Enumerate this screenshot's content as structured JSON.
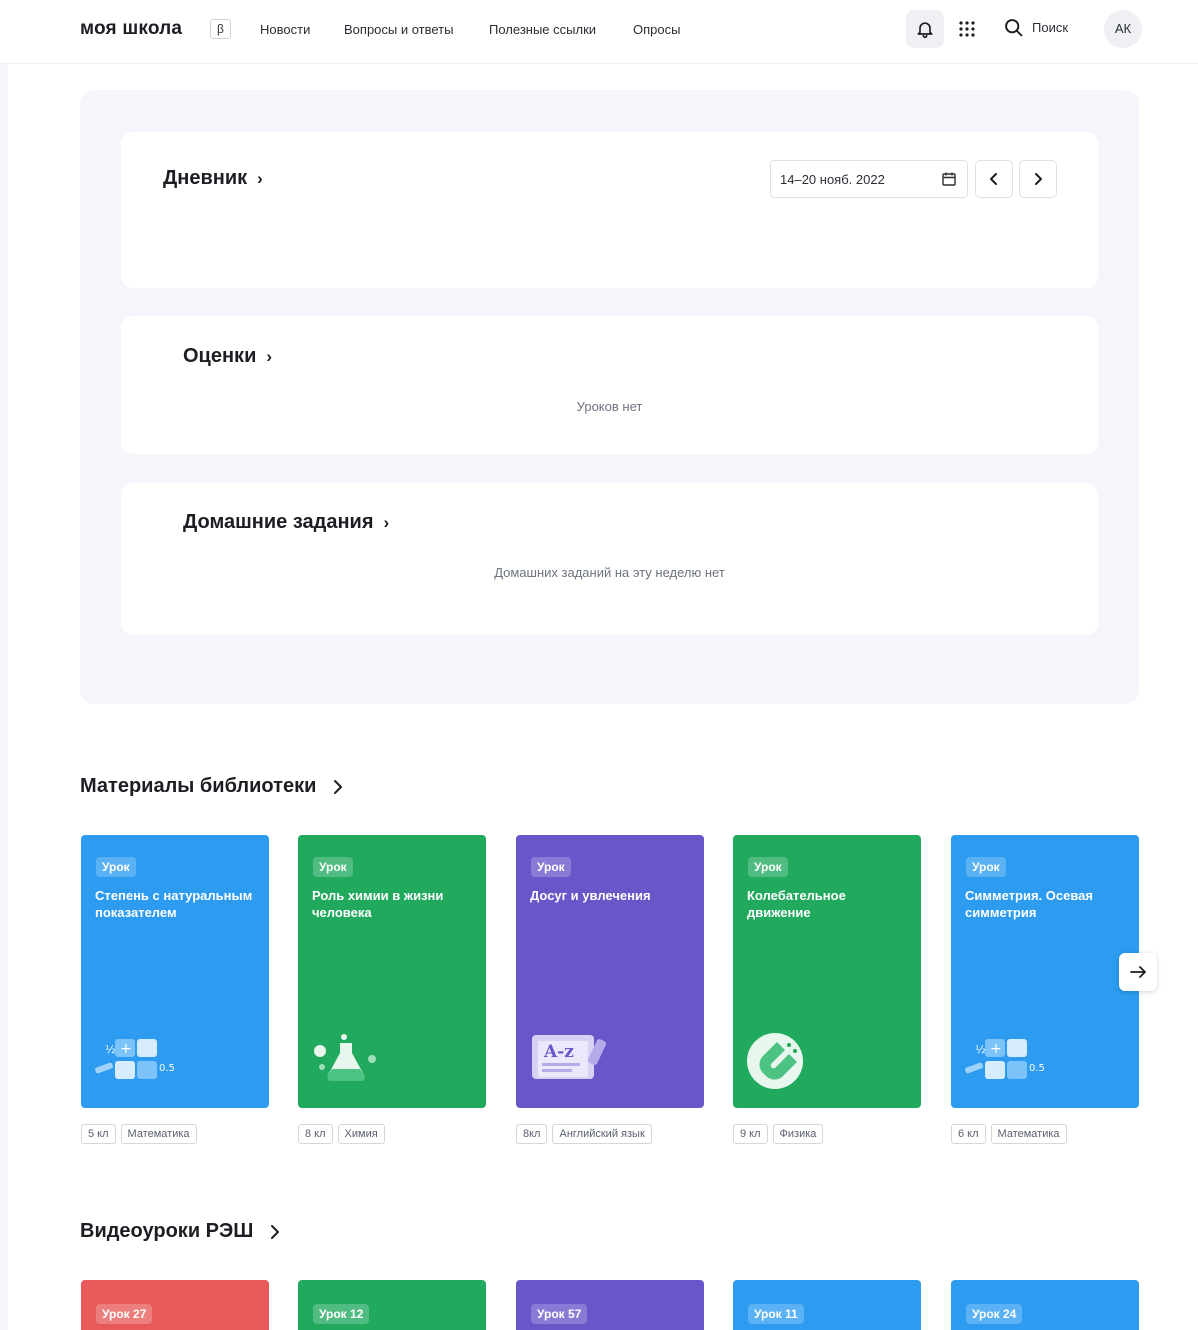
{
  "header": {
    "logo": "моя школа",
    "beta": "β",
    "nav": [
      "Новости",
      "Вопросы и ответы",
      "Полезные ссылки",
      "Опросы"
    ],
    "search_label": "Поиск",
    "avatar_initials": "АК",
    "icons": [
      "bell-icon",
      "apps-grid-icon",
      "search-icon"
    ]
  },
  "diary": {
    "title": "Дневник",
    "date_range": "14–20 нояб. 2022"
  },
  "grades": {
    "title": "Оценки",
    "empty": "Уроков нет"
  },
  "homework": {
    "title": "Домашние задания",
    "empty": "Домашних заданий на эту неделю нет"
  },
  "library": {
    "title": "Материалы библиотеки",
    "cards": [
      {
        "badge": "Урок",
        "name": "Степень с натуральным показателем",
        "grade": "5 кл",
        "subject": "Математика",
        "color": "#2c9bf0",
        "icon": "math-icon"
      },
      {
        "badge": "Урок",
        "name": "Роль химии в жизни человека",
        "grade": "8 кл",
        "subject": "Химия",
        "color": "#21a95e",
        "icon": "flask-icon"
      },
      {
        "badge": "Урок",
        "name": "Досуг и увлечения",
        "grade": "8кл",
        "subject": "Английский язык",
        "color": "#6a55c9",
        "icon": "dictionary-icon"
      },
      {
        "badge": "Урок",
        "name": "Колебательное движение",
        "grade": "9 кл",
        "subject": "Физика",
        "color": "#21a95e",
        "icon": "magnet-icon"
      },
      {
        "badge": "Урок",
        "name": "Симметрия. Осевая симметрия",
        "grade": "6 кл",
        "subject": "Математика",
        "color": "#2c9bf0",
        "icon": "math-icon"
      }
    ]
  },
  "video": {
    "title": "Видеоуроки РЭШ",
    "cards": [
      {
        "badge": "Урок 27",
        "color": "#e85a5a"
      },
      {
        "badge": "Урок 12",
        "color": "#21a95e"
      },
      {
        "badge": "Урок 57",
        "color": "#6a55c9"
      },
      {
        "badge": "Урок 11",
        "color": "#2c9bf0"
      },
      {
        "badge": "Урок 24",
        "color": "#2c9bf0"
      }
    ]
  }
}
